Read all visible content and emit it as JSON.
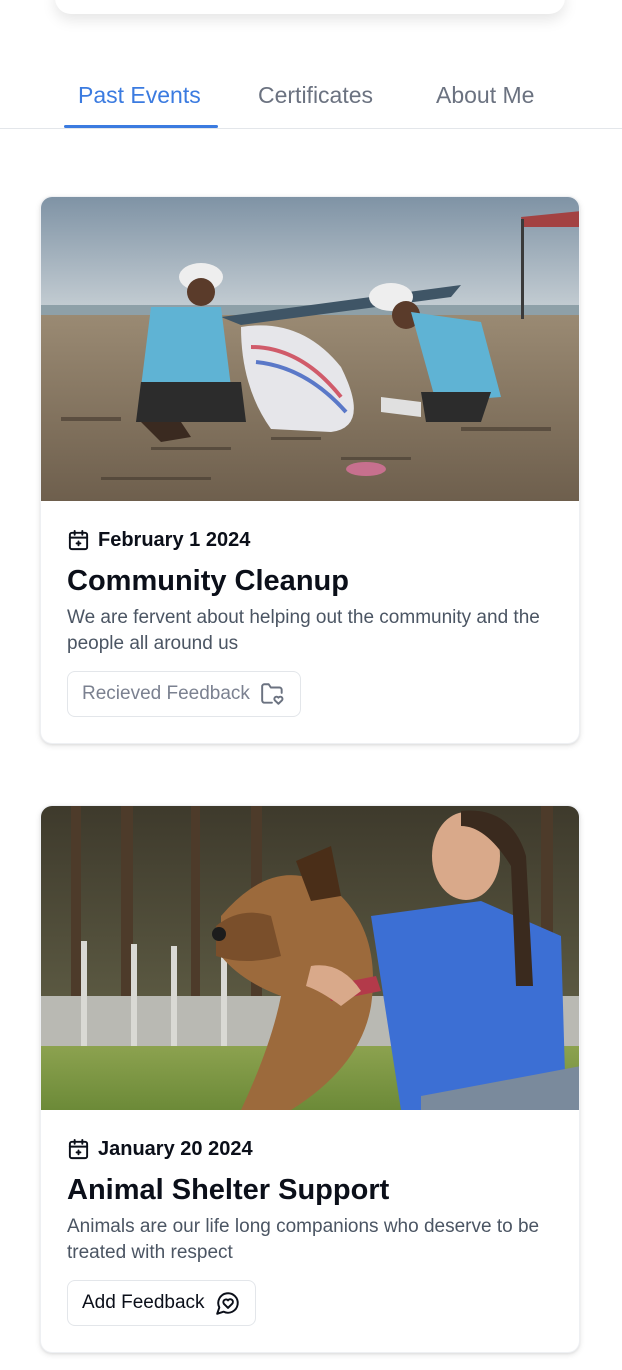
{
  "tabs": [
    {
      "label": "Past Events",
      "active": true
    },
    {
      "label": "Certificates",
      "active": false
    },
    {
      "label": "About Me",
      "active": false
    }
  ],
  "colors": {
    "accent": "#3b7be0",
    "text": "#0b0f19",
    "muted": "#4b5563"
  },
  "events": [
    {
      "date": "February 1 2024",
      "title": "Community Cleanup",
      "description": "We are fervent about helping out the community and the people all around us",
      "feedback_label": "Recieved Feedback",
      "feedback_icon": "folder-heart-icon",
      "image": "beach-cleanup-photo"
    },
    {
      "date": "January 20 2024",
      "title": "Animal Shelter Support",
      "description": "Animals are our life long companions who deserve to be treated with respect",
      "feedback_label": "Add Feedback",
      "feedback_icon": "chat-heart-icon",
      "image": "woman-with-dog-photo"
    }
  ]
}
